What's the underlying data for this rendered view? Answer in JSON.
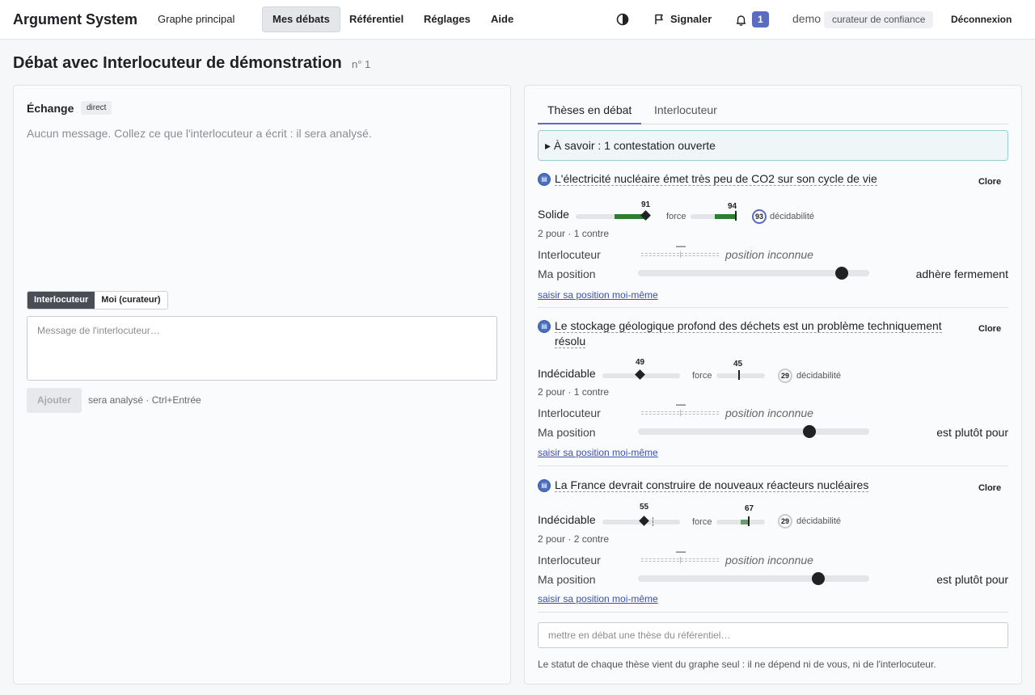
{
  "app": {
    "title": "Argument System"
  },
  "nav": {
    "items": [
      "Graphe principal",
      "Mes débats",
      "Référentiel",
      "Réglages",
      "Aide"
    ],
    "active": "Mes débats"
  },
  "header": {
    "signal_label": "Signaler",
    "notifications_count": "1",
    "user": "demo",
    "role": "curateur de confiance",
    "logout_label": "Déconnexion",
    "contrast_icon": "contrast-icon",
    "flag_icon": "flag-icon",
    "bell_icon": "bell-icon"
  },
  "page": {
    "title": "Débat avec Interlocuteur de démonstration",
    "number": "n° 1"
  },
  "exchange": {
    "title": "Échange",
    "mode": "direct",
    "empty_message": "Aucun message. Collez ce que l'interlocuteur a écrit : il sera analysé.",
    "speaker_options": [
      "Interlocuteur",
      "Moi (curateur)"
    ],
    "speaker_selected": "Interlocuteur",
    "input_placeholder": "Message de l'interlocuteur…",
    "add_label": "Ajouter",
    "add_hint": "sera analysé · Ctrl+Entrée"
  },
  "tabs": [
    "Thèses en débat",
    "Interlocuteur"
  ],
  "active_tab": "Thèses en débat",
  "notice": "▸ À savoir : 1 contestation ouverte",
  "labels": {
    "force": "force",
    "decidability": "décidabilité",
    "interlocutor": "Interlocuteur",
    "my_position": "Ma position",
    "unknown_position": "position inconnue",
    "interlocutor_value": "—",
    "self_position_link": "saisir sa position moi-même",
    "close": "Clore"
  },
  "theses": [
    {
      "title": "L'électricité nucléaire émet très peu de CO2 sur son cycle de vie",
      "status": "Solide",
      "solidity": 91,
      "force": 94,
      "decidability": 93,
      "pro_con": "2 pour · 1 contre",
      "my_position_text": "adhère fermement",
      "my_position_level": 0.88
    },
    {
      "title": "Le stockage géologique profond des déchets est un problème techniquement résolu",
      "status": "Indécidable",
      "solidity": 49,
      "force": 45,
      "decidability": 29,
      "pro_con": "2 pour · 1 contre",
      "my_position_text": "est plutôt pour",
      "my_position_level": 0.74
    },
    {
      "title": "La France devrait construire de nouveaux réacteurs nucléaires",
      "status": "Indécidable",
      "solidity": 55,
      "force": 67,
      "decidability": 29,
      "pro_con": "2 pour · 2 contre",
      "my_position_text": "est plutôt pour",
      "my_position_level": 0.78
    }
  ],
  "add_thesis_placeholder": "mettre en débat une thèse du référentiel…",
  "footnote": "Le statut de chaque thèse vient du graphe seul : il ne dépend ni de vous, ni de l'interlocuteur."
}
